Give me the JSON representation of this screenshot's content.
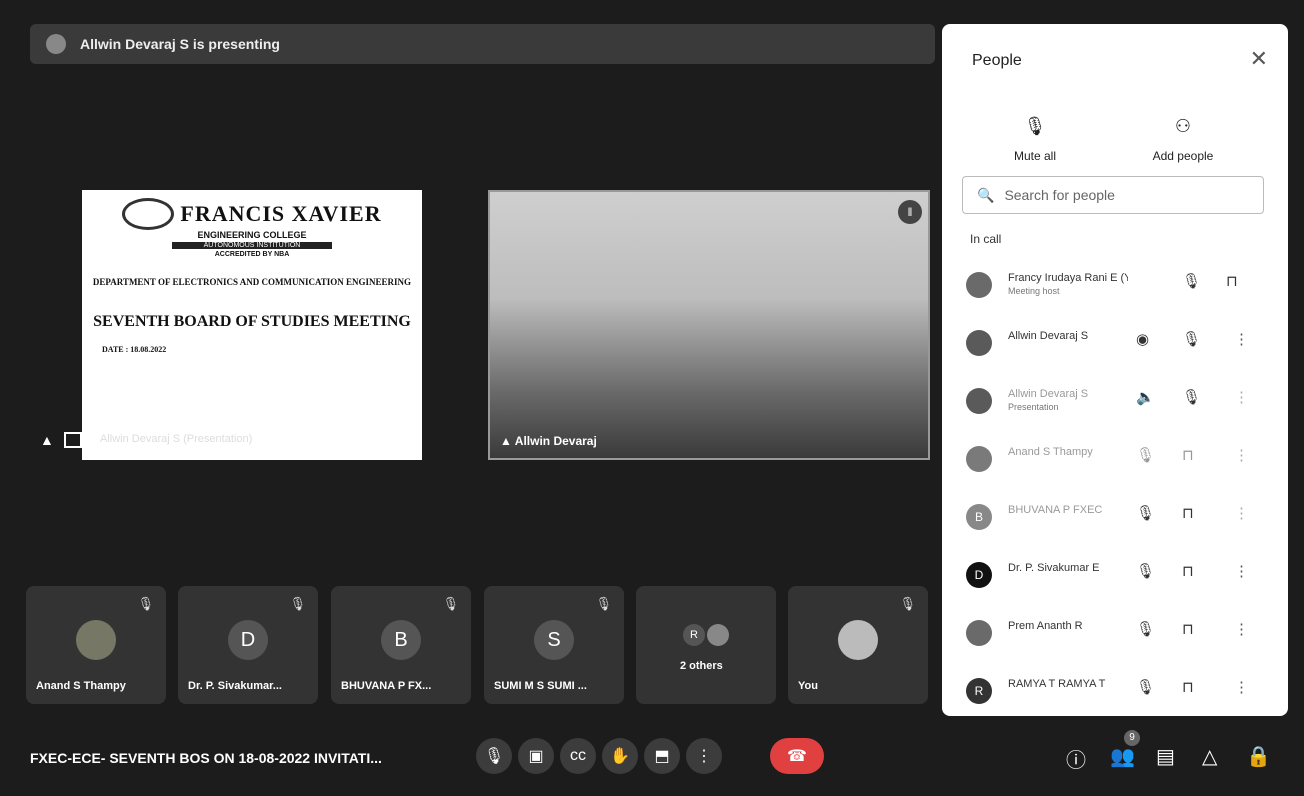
{
  "presenting": {
    "text": "Allwin Devaraj S is presenting"
  },
  "slide": {
    "college_name": "FRANCIS XAVIER",
    "college_sub": "ENGINEERING COLLEGE",
    "college_band": "AUTONOMOUS INSTITUTION",
    "accredited": "ACCREDITED BY NBA",
    "department": "DEPARTMENT OF ELECTRONICS AND COMMUNICATION ENGINEERING",
    "title": "SEVENTH BOARD OF STUDIES MEETING",
    "date": "DATE : 18.08.2022",
    "caption": "Allwin Devaraj S (Presentation)"
  },
  "video": {
    "caption": "Allwin Devaraj"
  },
  "tiles": [
    {
      "name": "Anand S Thampy",
      "initial": ""
    },
    {
      "name": "Dr. P. Sivakumar...",
      "initial": "D"
    },
    {
      "name": "BHUVANA P FX...",
      "initial": "B"
    },
    {
      "name": "SUMI M S SUMI ...",
      "initial": "S"
    },
    {
      "name": "2 others",
      "initial": "R"
    },
    {
      "name": "You",
      "initial": ""
    }
  ],
  "meeting_title": "FXEC-ECE- SEVENTH BOS ON 18-08-2022 INVITATI...",
  "people_badge": "9",
  "panel": {
    "title": "People",
    "mute_all": "Mute all",
    "add_people": "Add people",
    "search_placeholder": "Search for people",
    "in_call": "In call",
    "participants": [
      {
        "name": "Francy Irudaya Rani E (You)",
        "sub": "Meeting host",
        "initial": ""
      },
      {
        "name": "Allwin Devaraj S",
        "sub": "",
        "initial": ""
      },
      {
        "name": "Allwin Devaraj S",
        "sub": "Presentation",
        "initial": ""
      },
      {
        "name": "Anand S Thampy",
        "sub": "",
        "initial": ""
      },
      {
        "name": "BHUVANA P FXEC",
        "sub": "",
        "initial": "B"
      },
      {
        "name": "Dr. P. Sivakumar E",
        "sub": "",
        "initial": "D"
      },
      {
        "name": "Prem Ananth R",
        "sub": "",
        "initial": ""
      },
      {
        "name": "RAMYA T RAMYA T",
        "sub": "",
        "initial": "R"
      }
    ]
  }
}
